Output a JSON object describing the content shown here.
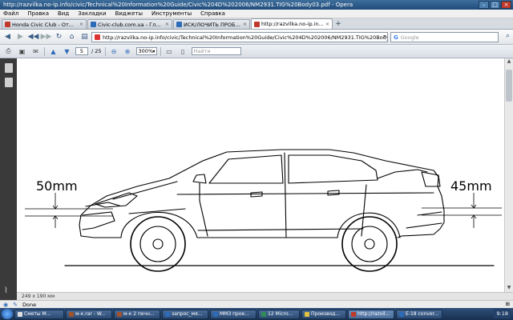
{
  "window": {
    "title": "http://razvilka.no-ip.info/civic/Technical%20Information%20Guide/Civic%204D%202006/NM2931.TIG%20Body03.pdf - Opera"
  },
  "menu": [
    "Файл",
    "Правка",
    "Вид",
    "Закладки",
    "Виджеты",
    "Инструменты",
    "Справка"
  ],
  "tabs": [
    {
      "label": "Honda Civic Club - От...",
      "color": "#c0392b"
    },
    {
      "label": "Civic-club.com.ua - Гл...",
      "color": "#2d6ab8"
    },
    {
      "label": "ИСК/ЛОЧИТЬ ПРОБО...",
      "color": "#2d6ab8"
    },
    {
      "label": "http://razvilka.no-ip.in...",
      "color": "#c0392b"
    }
  ],
  "address": {
    "url": "http://razvilka.no-ip.info/civic/Technical%20Information%20Guide/Civic%204D%202006/NM2931.TIG%20Body03.pdf"
  },
  "search": {
    "placeholder": "Google",
    "engine_glyph": "G"
  },
  "pdf_toolbar": {
    "current_page": "5",
    "total_pages": "/ 25",
    "zoom": "300%",
    "find_placeholder": "Найти"
  },
  "drawing": {
    "front_clearance": "50mm",
    "rear_clearance": "45mm"
  },
  "doc_size": "249 x 190 мм",
  "status": {
    "text": "Done"
  },
  "taskbar": [
    {
      "label": "Сметы М...",
      "color": "#e0e0e0"
    },
    {
      "label": "м-к.rar - W...",
      "color": "#a0522d"
    },
    {
      "label": "м-к 2 печн...",
      "color": "#a0522d"
    },
    {
      "label": "запрос_мя...",
      "color": "#2d6ab8"
    },
    {
      "label": "ММЗ прое...",
      "color": "#2d6ab8"
    },
    {
      "label": "12 Micro...",
      "color": "#2e8b57"
    },
    {
      "label": "Производ...",
      "color": "#e0c040"
    },
    {
      "label": "http://razvil...",
      "color": "#c0392b",
      "active": true
    },
    {
      "label": "E-18 conver...",
      "color": "#2d6ab8"
    }
  ],
  "clock": "9:18"
}
